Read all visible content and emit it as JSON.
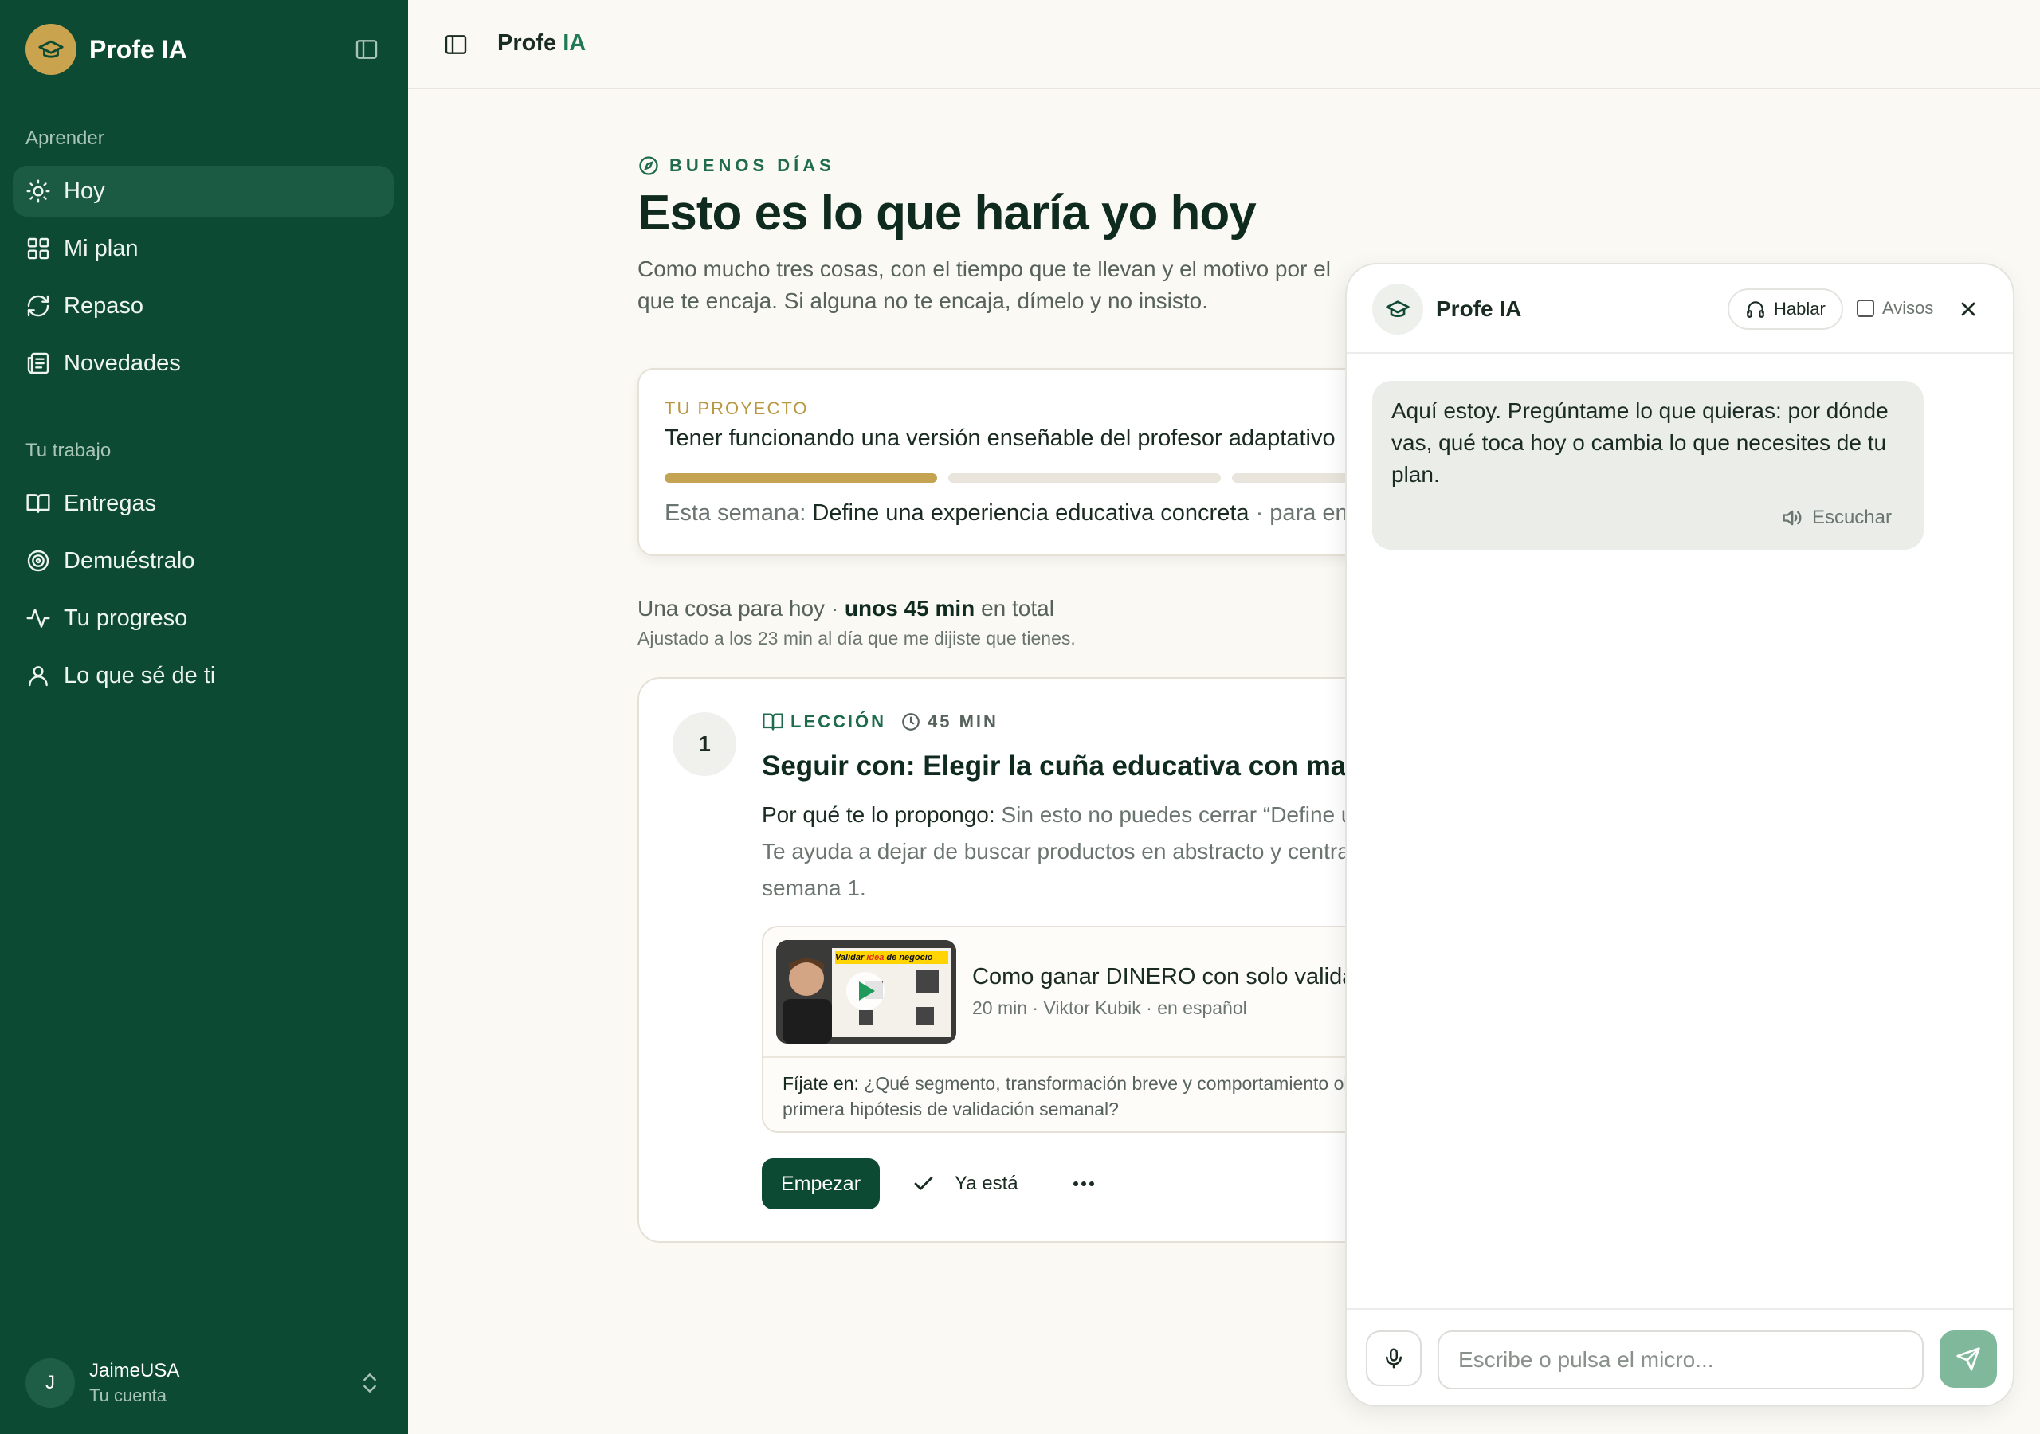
{
  "app": {
    "name": "Profe IA",
    "title_main": "Profe",
    "title_accent": "IA"
  },
  "colors": {
    "sidebar_bg": "#0d4a33",
    "accent_gold": "#c9a34e",
    "accent_green": "#1f7a55",
    "page_bg": "#fbf9f4"
  },
  "sidebar": {
    "section_learn": "Aprender",
    "learn_items": [
      {
        "label": "Hoy",
        "icon": "sun-icon",
        "active": true
      },
      {
        "label": "Mi plan",
        "icon": "grid-icon"
      },
      {
        "label": "Repaso",
        "icon": "refresh-icon"
      },
      {
        "label": "Novedades",
        "icon": "newspaper-icon"
      }
    ],
    "section_work": "Tu trabajo",
    "work_items": [
      {
        "label": "Entregas",
        "icon": "book-open-icon"
      },
      {
        "label": "Demuéstralo",
        "icon": "target-icon"
      },
      {
        "label": "Tu progreso",
        "icon": "activity-icon"
      },
      {
        "label": "Lo que sé de ti",
        "icon": "user-icon"
      }
    ],
    "account": {
      "initial": "J",
      "name": "JaimeUSA",
      "subtitle": "Tu cuenta"
    }
  },
  "main": {
    "greeting": "BUENOS DÍAS",
    "headline": "Esto es lo que haría yo hoy",
    "intro": "Como mucho tres cosas, con el tiempo que te llevan y el motivo por el que te encaja. Si alguna no te encaja, dímelo y no insisto.",
    "project": {
      "label": "TU PROYECTO",
      "title": "Tener funcionando una versión enseñable del profesor adaptativo",
      "progress_segments": 3,
      "progress_filled": 1,
      "week_prefix": "Esta semana:",
      "week_goal": "Define una experiencia educativa concreta",
      "week_suffix": "· para en"
    },
    "today_prefix": "Una cosa para hoy ·",
    "today_strong": "unos 45 min",
    "today_suffix": "en total",
    "today_sub": "Ajustado a los 23 min al día que me dijiste que tienes.",
    "lesson": {
      "number": "1",
      "kind": "LECCIÓN",
      "duration": "45 MIN",
      "title": "Seguir con: Elegir la cuña educativa con mayor potencial",
      "why_label": "Por qué te lo propongo:",
      "why_text": "Sin esto no puedes cerrar “Define una experiencia educativa concreta”. Te ayuda a dejar de buscar productos en abstracto y centrarte en uno. Sin esto no completas la semana 1.",
      "video": {
        "title": "Como ganar DINERO con solo validar ideas",
        "meta": "20 min · Viktor Kubik · en español",
        "thumb_caption_1": "Validar",
        "thumb_caption_2": "idea",
        "thumb_caption_3": "de negocio",
        "note_label": "Fíjate en:",
        "note_text": "¿Qué segmento, transformación breve y comportamiento observable —en una sesión— formarán tu primera hipótesis de validación semanal?"
      },
      "start_label": "Empezar",
      "done_label": "Ya está"
    }
  },
  "chat": {
    "name": "Profe IA",
    "talk_label": "Hablar",
    "alerts_label": "Avisos",
    "message": "Aquí estoy. Pregúntame lo que quieras: por dónde vas, qué toca hoy o cambia lo que necesites de tu plan.",
    "listen_label": "Escuchar",
    "input_placeholder": "Escribe o pulsa el micro..."
  }
}
